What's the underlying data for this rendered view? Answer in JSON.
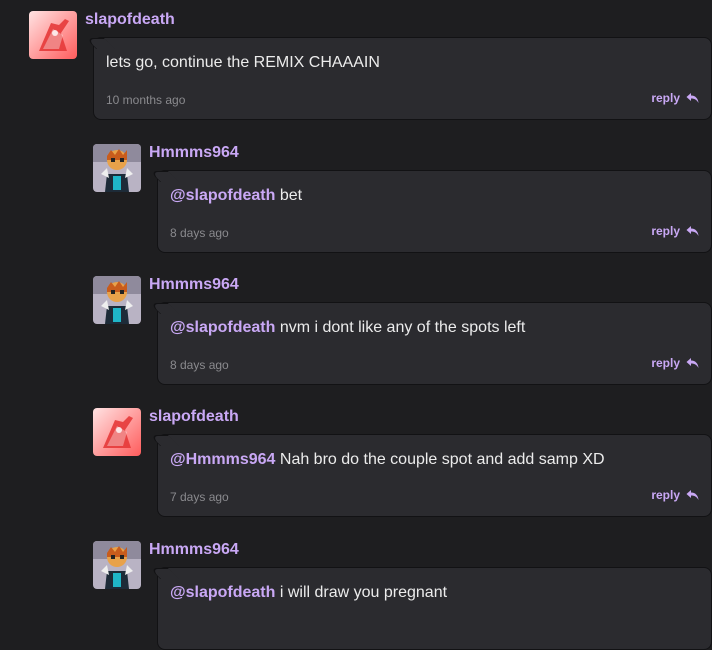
{
  "colors": {
    "background": "#1e1e20",
    "bubble": "#2b2b2f",
    "accent": "#c9a8f5",
    "text": "#ececec",
    "muted": "#8a8a8e"
  },
  "comments": [
    {
      "username": "slapofdeath",
      "avatar_icon": "red-avatar-icon",
      "mention": "",
      "text": "lets go, continue the REMIX CHAAAIN",
      "timestamp": "10 months ago",
      "reply_label": "reply"
    },
    {
      "username": "Hmmms964",
      "avatar_icon": "character-avatar-icon",
      "mention": "@slapofdeath",
      "text": " bet",
      "timestamp": "8 days ago",
      "reply_label": "reply"
    },
    {
      "username": "Hmmms964",
      "avatar_icon": "character-avatar-icon",
      "mention": "@slapofdeath",
      "text": " nvm i dont like any of the spots left",
      "timestamp": "8 days ago",
      "reply_label": "reply"
    },
    {
      "username": "slapofdeath",
      "avatar_icon": "red-avatar-icon",
      "mention": "@Hmmms964",
      "text": " Nah bro do the couple spot and add samp XD",
      "timestamp": "7 days ago",
      "reply_label": "reply"
    },
    {
      "username": "Hmmms964",
      "avatar_icon": "character-avatar-icon",
      "mention": "@slapofdeath",
      "text": " i will draw you pregnant",
      "timestamp": "",
      "reply_label": ""
    }
  ]
}
